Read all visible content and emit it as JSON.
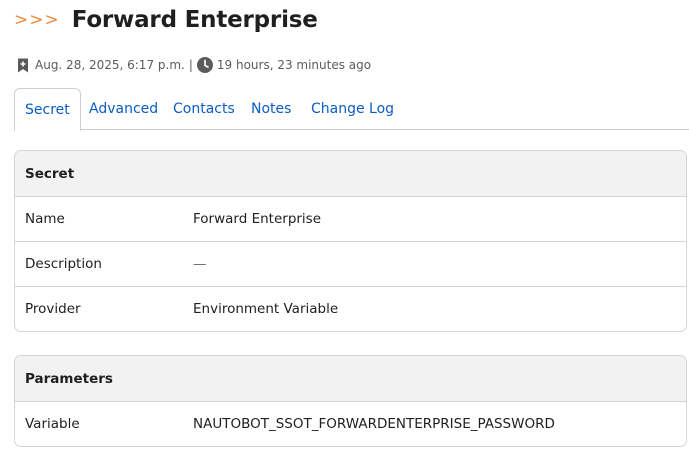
{
  "header": {
    "chevrons": ">>>",
    "title": "Forward Enterprise"
  },
  "meta": {
    "created_icon": "bookmark-icon",
    "created": "Aug. 28, 2025, 6:17 p.m.",
    "separator": "|",
    "updated_icon": "clock-icon",
    "updated": "19 hours, 23 minutes ago"
  },
  "tabs": [
    {
      "label": "Secret",
      "active": true
    },
    {
      "label": "Advanced",
      "active": false
    },
    {
      "label": "Contacts",
      "active": false
    },
    {
      "label": "Notes",
      "active": false
    },
    {
      "label": "Change Log",
      "active": false
    }
  ],
  "secret_panel": {
    "heading": "Secret",
    "rows": [
      {
        "key": "Name",
        "value": "Forward Enterprise"
      },
      {
        "key": "Description",
        "value": "—"
      },
      {
        "key": "Provider",
        "value": "Environment Variable"
      }
    ]
  },
  "parameters_panel": {
    "heading": "Parameters",
    "rows": [
      {
        "key": "Variable",
        "value": "NAUTOBOT_SSOT_FORWARDENTERPRISE_PASSWORD"
      }
    ]
  },
  "colors": {
    "accent": "#f0883e",
    "link": "#0b5cc4",
    "heading_bg": "#f2f2f2",
    "border": "#d4d4d4"
  }
}
